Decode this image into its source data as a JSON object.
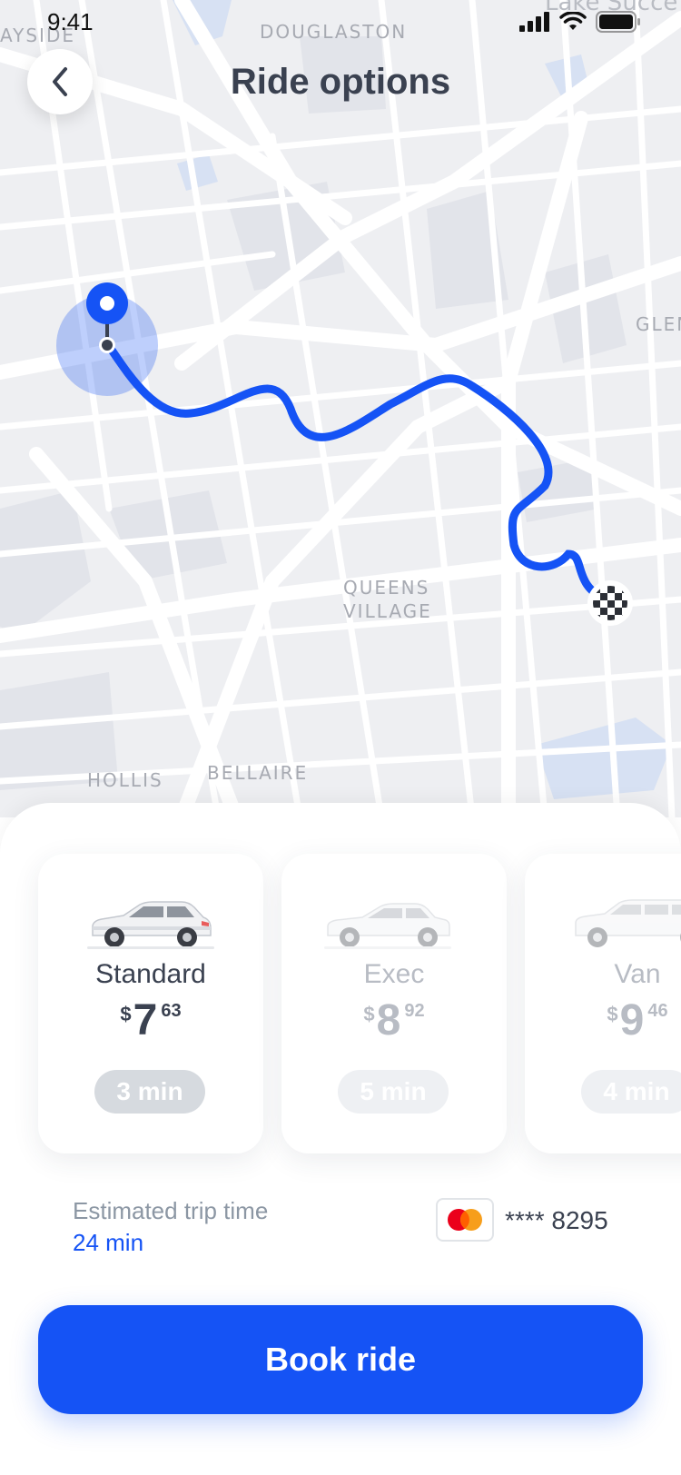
{
  "status_bar": {
    "time": "9:41",
    "icons": [
      "signal-icon",
      "wifi-icon",
      "battery-icon"
    ]
  },
  "header": {
    "back_icon": "chevron-left-icon",
    "title": "Ride options"
  },
  "map": {
    "labels": {
      "bayside": "AYSIDE",
      "douglaston": "DOUGLASTON",
      "lake_success": "Lake Succe",
      "glen": "GLEN",
      "queens": "QUEENS",
      "village": "VILLAGE",
      "hollis": "HOLLIS",
      "bellaire": "BELLAIRE"
    },
    "route_color": "#1553f5",
    "origin_icon": "pin-icon",
    "destination_icon": "checkered-flag-icon"
  },
  "ride_options": [
    {
      "name": "Standard",
      "currency": "$",
      "price_main": "7",
      "price_cents": "63",
      "eta": "3 min",
      "selected": true
    },
    {
      "name": "Exec",
      "currency": "$",
      "price_main": "8",
      "price_cents": "92",
      "eta": "5 min",
      "selected": false
    },
    {
      "name": "Van",
      "currency": "$",
      "price_main": "9",
      "price_cents": "46",
      "eta": "4 min",
      "selected": false
    }
  ],
  "trip": {
    "label": "Estimated trip time",
    "value": "24 min"
  },
  "payment": {
    "icon": "mastercard-icon",
    "card_number": "**** 8295"
  },
  "book_button": {
    "label": "Book ride"
  },
  "colors": {
    "accent": "#1553f5",
    "text_primary": "#3a4150",
    "text_muted": "#8c97a4",
    "map_background": "#eeeff2"
  }
}
